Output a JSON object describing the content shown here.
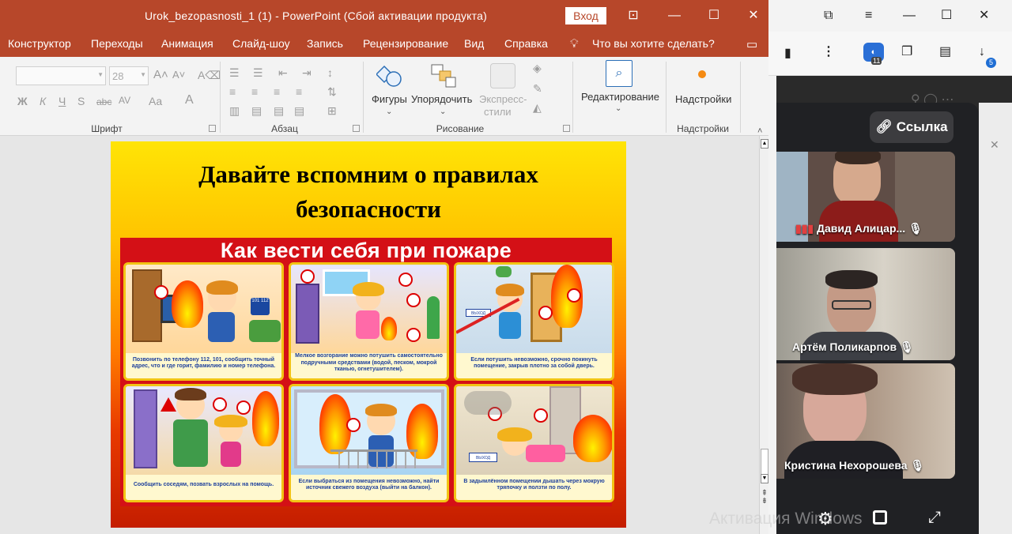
{
  "powerpoint": {
    "window_title": "Urok_bezopasnosti_1 (1)  -  PowerPoint (Сбой активации продукта)",
    "login_button": "Вход",
    "menu": [
      "Конструктор",
      "Переходы",
      "Анимация",
      "Слайд-шоу",
      "Запись",
      "Рецензирование",
      "Вид",
      "Справка"
    ],
    "tell_me": "Что вы хотите сделать?",
    "ribbon": {
      "font_size": "28",
      "font_group": "Шрифт",
      "paragraph_group": "Абзац",
      "drawing_group": "Рисование",
      "addins_group": "Надстройки",
      "shapes": "Фигуры",
      "arrange": "Упорядочить",
      "quick_styles_1": "Экспресс-",
      "quick_styles_2": "стили",
      "editing": "Редактирование",
      "addins": "Надстройки"
    }
  },
  "slide": {
    "title_line1": "Давайте вспомним о правилах",
    "title_line2": "безопасности",
    "poster_title": "Как вести себя при пожаре",
    "cards": [
      {
        "caption": "Позвонить по телефону 112, 101, сообщить точный адрес, что и где горит, фамилию и номер телефона.",
        "badge": "101 112"
      },
      {
        "caption": "Мелкое возгорание можно потушить самостоятельно подручными средствами (водой, песком, мокрой тканью, огнетушителем).",
        "badge": ""
      },
      {
        "caption": "Если потушить невозможно, срочно покинуть помещение, закрыв плотно за собой дверь.",
        "badge": "ВЫХОД"
      },
      {
        "caption": "Сообщить соседям, позвать взрослых на помощь.",
        "badge": ""
      },
      {
        "caption": "Если выбраться из помещения невозможно, найти источник свежего воздуха (выйти на балкон).",
        "badge": ""
      },
      {
        "caption": "В задымлённом помещении дышать через мокрую тряпочку и ползти по полу.",
        "badge": "ВЫХОД"
      }
    ]
  },
  "browser": {
    "tab_count_badge": "11",
    "download_badge": "5",
    "link_button": "Ссылка",
    "participants": [
      {
        "name": "Давид Алицар..."
      },
      {
        "name": "Артём Поликарпов"
      },
      {
        "name": "Кристина Нехорошева"
      }
    ]
  },
  "watermark": "Активация Windows",
  "colors": {
    "ppt_accent": "#b7472a",
    "meet_bg": "#202124",
    "poster_red": "#d41016"
  }
}
